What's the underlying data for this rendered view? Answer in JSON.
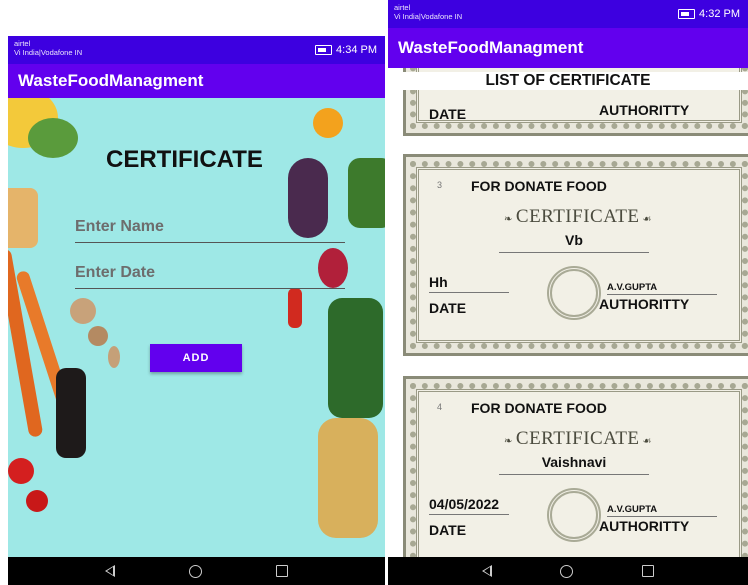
{
  "left_screen": {
    "status": {
      "carrier_line1": "airtel",
      "carrier_line2": "Vi India|Vodafone IN",
      "time": "4:34 PM"
    },
    "app_title": "WasteFoodManagment",
    "heading": "CERTIFICATE",
    "name_field": {
      "placeholder": "Enter Name"
    },
    "date_field": {
      "placeholder": "Enter Date"
    },
    "add_button": "ADD"
  },
  "right_screen": {
    "status": {
      "carrier_line1": "airtel",
      "carrier_line2": "Vi India|Vodafone IN",
      "time": "4:32 PM"
    },
    "app_title": "WasteFoodManagment",
    "list_heading": "LIST OF CERTIFICATE",
    "partial_cert": {
      "date_label": "DATE",
      "authority_label": "AUTHORITTY"
    },
    "certificates": [
      {
        "number": "3",
        "header": "FOR DONATE FOOD",
        "subtitle": "CERTIFICATE",
        "name": "Vb",
        "date_value": "Hh",
        "date_label": "DATE",
        "signatory": "A.V.GUPTA",
        "authority_label": "AUTHORITTY"
      },
      {
        "number": "4",
        "header": "FOR DONATE FOOD",
        "subtitle": "CERTIFICATE",
        "name": "Vaishnavi",
        "date_value": "04/05/2022",
        "date_label": "DATE",
        "signatory": "A.V.GUPTA",
        "authority_label": "AUTHORITTY"
      }
    ]
  },
  "colors": {
    "status_bar": "#3d00e0",
    "app_bar": "#6200ee",
    "form_background": "#9ee8e6",
    "button": "#6200ee"
  },
  "icons": [
    "nav-back-icon",
    "nav-home-icon",
    "nav-recent-icon",
    "battery-icon",
    "signal-icon"
  ]
}
